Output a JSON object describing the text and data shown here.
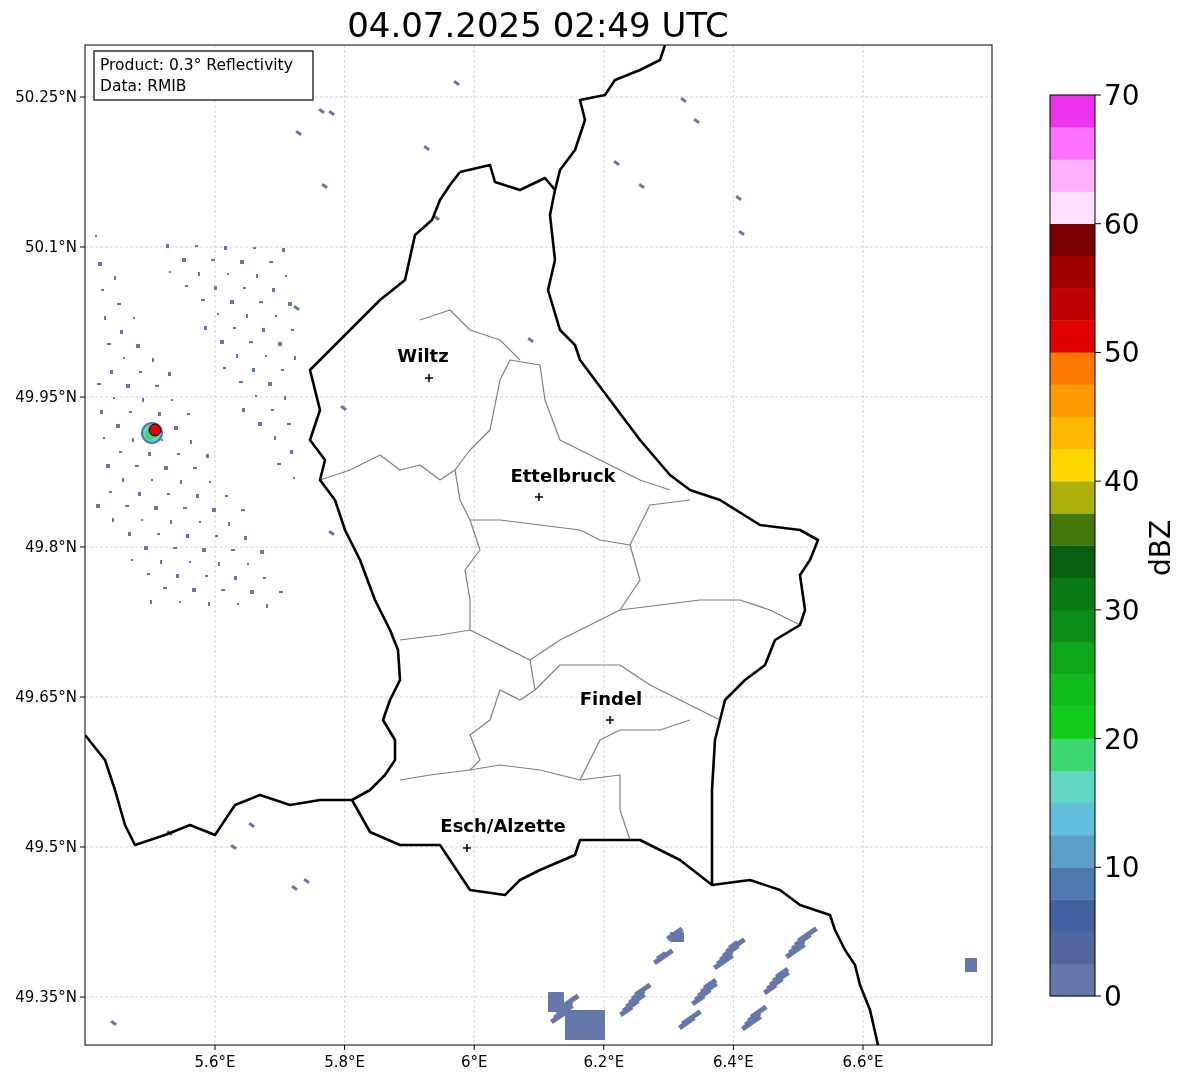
{
  "title": "04.07.2025 02:49 UTC",
  "info_box": [
    "Product: 0.3° Reflectivity",
    "Data: RMIB"
  ],
  "lat_ticks": [
    "50.25°N",
    "50.1°N",
    "49.95°N",
    "49.8°N",
    "49.65°N",
    "49.5°N",
    "49.35°N"
  ],
  "lon_ticks": [
    "5.6°E",
    "5.8°E",
    "6°E",
    "6.2°E",
    "6.4°E",
    "6.6°E"
  ],
  "cities": [
    {
      "name": "Wiltz"
    },
    {
      "name": "Ettelbruck"
    },
    {
      "name": "Findel"
    },
    {
      "name": "Esch/Alzette"
    }
  ],
  "colorbar": {
    "label": "dBZ",
    "ticks": [
      "70",
      "60",
      "50",
      "40",
      "30",
      "20",
      "10",
      "0"
    ],
    "segments": [
      {
        "color": "#6677a9"
      },
      {
        "color": "#53679e"
      },
      {
        "color": "#4360a0"
      },
      {
        "color": "#4b79b0"
      },
      {
        "color": "#5a9fc7"
      },
      {
        "color": "#62c0dd"
      },
      {
        "color": "#60d8c4"
      },
      {
        "color": "#3ed870"
      },
      {
        "color": "#11cc1a"
      },
      {
        "color": "#10bc1c"
      },
      {
        "color": "#0ea61a"
      },
      {
        "color": "#0b8d18"
      },
      {
        "color": "#0a7a14"
      },
      {
        "color": "#075f10"
      },
      {
        "color": "#44780a"
      },
      {
        "color": "#b0b00a"
      },
      {
        "color": "#ffd800"
      },
      {
        "color": "#ffb800"
      },
      {
        "color": "#ff9a00"
      },
      {
        "color": "#ff7a00"
      },
      {
        "color": "#e00000"
      },
      {
        "color": "#c00000"
      },
      {
        "color": "#a00000"
      },
      {
        "color": "#7a0000"
      },
      {
        "color": "#ffe0ff"
      },
      {
        "color": "#ffb0ff"
      },
      {
        "color": "#ff70ff"
      },
      {
        "color": "#ee33ee"
      }
    ]
  }
}
